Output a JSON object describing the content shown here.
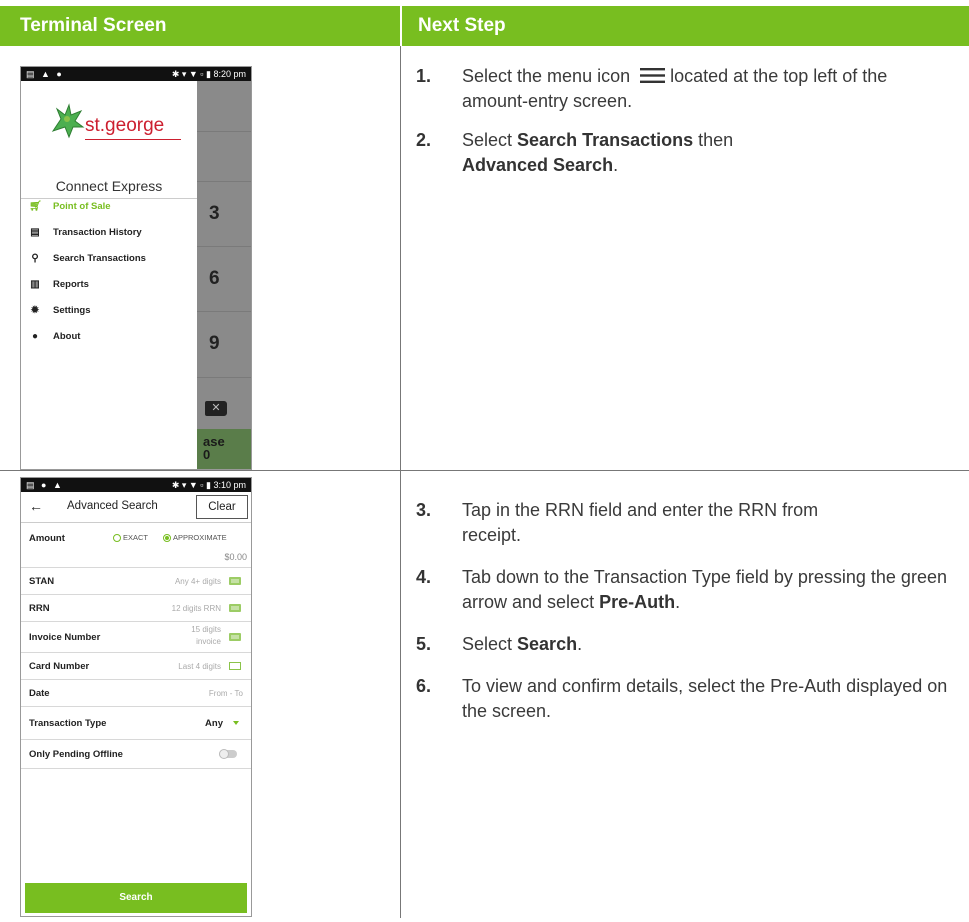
{
  "headers": {
    "left": "Terminal Screen",
    "right": "Next Step"
  },
  "phone1": {
    "status_time": "8:20 pm",
    "brand": "st.george",
    "app_title": "Connect Express",
    "menu": [
      {
        "label": "Point of Sale",
        "icon": "cart-icon"
      },
      {
        "label": "Transaction History",
        "icon": "receipt-icon"
      },
      {
        "label": "Search Transactions",
        "icon": "search-icon"
      },
      {
        "label": "Reports",
        "icon": "chart-icon"
      },
      {
        "label": "Settings",
        "icon": "gear-icon"
      },
      {
        "label": "About",
        "icon": "info-icon"
      }
    ],
    "keys": [
      "3",
      "6",
      "9"
    ],
    "partial_button_line1": "ase",
    "partial_button_line2": "0",
    "accent": "#78be20"
  },
  "phone2": {
    "status_time": "3:10 pm",
    "title": "Advanced Search",
    "clear_label": "Clear",
    "amount_label": "Amount",
    "radio_exact": "EXACT",
    "radio_approx": "APPROXIMATE",
    "amount_value": "$0.00",
    "fields": [
      {
        "label": "STAN",
        "hint": "Any 4+ digits"
      },
      {
        "label": "RRN",
        "hint": "12 digits RRN"
      },
      {
        "label": "Invoice Number",
        "hint1": "15 digits",
        "hint2": "invoice"
      },
      {
        "label": "Card Number",
        "hint": "Last 4 digits"
      },
      {
        "label": "Date",
        "hint": "From - To"
      },
      {
        "label": "Transaction Type",
        "value": "Any"
      },
      {
        "label": "Only Pending Offline"
      }
    ],
    "search_label": "Search"
  },
  "steps_top": [
    {
      "num": "1.",
      "pre": "Select the menu icon",
      "post": "located at the top left of the amount-entry screen."
    },
    {
      "num": "2.",
      "pre": "Select ",
      "bold1": "Search Transactions",
      "mid": " then ",
      "bold2": "Advanced Search",
      "post": "."
    }
  ],
  "steps_bottom": [
    {
      "num": "3.",
      "text": "Tap in the RRN field and enter the RRN from receipt."
    },
    {
      "num": "4.",
      "pre": "Tab down to the Transaction Type field by pressing the green arrow and select ",
      "bold": "Pre-Auth",
      "post": "."
    },
    {
      "num": "5.",
      "pre": "Select ",
      "bold": "Search",
      "post": "."
    },
    {
      "num": "6.",
      "text": "To view and confirm details, select the Pre-Auth displayed on the screen."
    }
  ]
}
